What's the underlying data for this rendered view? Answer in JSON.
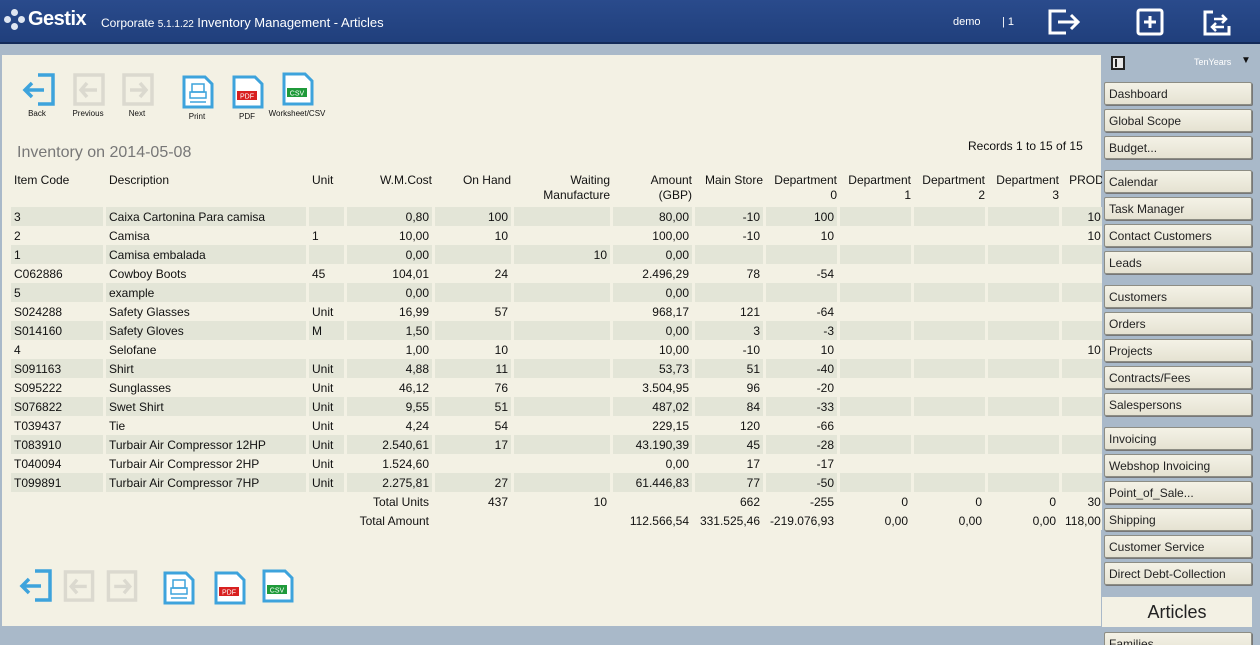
{
  "header": {
    "logo": "Gestix",
    "app_name": "Corporate",
    "version": "5.1.1.22",
    "module": "Inventory Management - Articles",
    "user": "demo",
    "user_id": "| 1"
  },
  "toolbar": {
    "back": "Back",
    "previous": "Previous",
    "next": "Next",
    "print": "Print",
    "pdf": "PDF",
    "csv": "Worksheet/CSV",
    "pdf_badge": "PDF",
    "csv_badge": "CSV"
  },
  "report": {
    "title": "Inventory on 2014-05-08",
    "records": "Records 1 to 15 of 15"
  },
  "table": {
    "headers": {
      "item_code": "Item Code",
      "description": "Description",
      "unit": "Unit",
      "wmcost": "W.M.Cost",
      "on_hand": "On Hand",
      "waiting_1": "Waiting",
      "waiting_2": "Manufacture",
      "amount_1": "Amount",
      "amount_2": "(GBP)",
      "main_store": "Main Store",
      "dept0_1": "Department",
      "dept0_2": "0",
      "dept1_1": "Department",
      "dept1_2": "1",
      "dept2_1": "Department",
      "dept2_2": "2",
      "dept3_1": "Department",
      "dept3_2": "3",
      "prod": "PROD"
    },
    "rows": [
      [
        "3",
        "Caixa Cartonina Para camisa",
        "",
        "0,80",
        "100",
        "",
        "80,00",
        "-10",
        "100",
        "",
        "",
        "",
        "10"
      ],
      [
        "2",
        "Camisa",
        "1",
        "10,00",
        "10",
        "",
        "100,00",
        "-10",
        "10",
        "",
        "",
        "",
        "10"
      ],
      [
        "1",
        "Camisa embalada",
        "",
        "0,00",
        "",
        "10",
        "0,00",
        "",
        "",
        "",
        "",
        "",
        ""
      ],
      [
        "C062886",
        "Cowboy Boots",
        "45",
        "104,01",
        "24",
        "",
        "2.496,29",
        "78",
        "-54",
        "",
        "",
        "",
        ""
      ],
      [
        "5",
        "example",
        "",
        "0,00",
        "",
        "",
        "0,00",
        "",
        "",
        "",
        "",
        "",
        ""
      ],
      [
        "S024288",
        "Safety Glasses",
        "Unit",
        "16,99",
        "57",
        "",
        "968,17",
        "121",
        "-64",
        "",
        "",
        "",
        ""
      ],
      [
        "S014160",
        "Safety Gloves",
        "M",
        "1,50",
        "",
        "",
        "0,00",
        "3",
        "-3",
        "",
        "",
        "",
        ""
      ],
      [
        "4",
        "Selofane",
        "",
        "1,00",
        "10",
        "",
        "10,00",
        "-10",
        "10",
        "",
        "",
        "",
        "10"
      ],
      [
        "S091163",
        "Shirt",
        "Unit",
        "4,88",
        "11",
        "",
        "53,73",
        "51",
        "-40",
        "",
        "",
        "",
        ""
      ],
      [
        "S095222",
        "Sunglasses",
        "Unit",
        "46,12",
        "76",
        "",
        "3.504,95",
        "96",
        "-20",
        "",
        "",
        "",
        ""
      ],
      [
        "S076822",
        "Swet Shirt",
        "Unit",
        "9,55",
        "51",
        "",
        "487,02",
        "84",
        "-33",
        "",
        "",
        "",
        ""
      ],
      [
        "T039437",
        "Tie",
        "Unit",
        "4,24",
        "54",
        "",
        "229,15",
        "120",
        "-66",
        "",
        "",
        "",
        ""
      ],
      [
        "T083910",
        "Turbair Air Compressor 12HP",
        "Unit",
        "2.540,61",
        "17",
        "",
        "43.190,39",
        "45",
        "-28",
        "",
        "",
        "",
        ""
      ],
      [
        "T040094",
        "Turbair Air Compressor 2HP",
        "Unit",
        "1.524,60",
        "",
        "",
        "0,00",
        "17",
        "-17",
        "",
        "",
        "",
        ""
      ],
      [
        "T099891",
        "Turbair Air Compressor 7HP",
        "Unit",
        "2.275,81",
        "27",
        "",
        "61.446,83",
        "77",
        "-50",
        "",
        "",
        "",
        ""
      ]
    ],
    "totals": {
      "units_label": "Total Units",
      "units": [
        "437",
        "10",
        "",
        "662",
        "-255",
        "0",
        "0",
        "0",
        "30"
      ],
      "amount_label": "Total Amount",
      "amount": [
        "",
        "",
        "112.566,54",
        "331.525,46",
        "-219.076,93",
        "0,00",
        "0,00",
        "0,00",
        "118,00"
      ]
    }
  },
  "sidebar": {
    "company": "TenYears",
    "caret": "▼",
    "items": [
      "Dashboard",
      "Global Scope",
      "Budget...",
      "Calendar",
      "Task Manager",
      "Contact Customers",
      "Leads",
      "Customers",
      "Orders",
      "Projects",
      "Contracts/Fees",
      "Salespersons",
      "Invoicing",
      "Webshop Invoicing",
      "Point_of_Sale...",
      "Shipping",
      "Customer Service",
      "Direct Debt-Collection"
    ],
    "active": "Articles",
    "partial": "Families"
  },
  "colors": {
    "header_bg": "#2a4b8c",
    "panel_bg": "#f3f1e4",
    "sidebar_bg": "#a9b9c9",
    "icon_blue": "#3da3dc",
    "pdf_red": "#d82020",
    "csv_green": "#1f9a3a"
  },
  "icons": {
    "logout": "logout-icon",
    "new": "add-window-icon",
    "switch": "switch-window-icon"
  }
}
